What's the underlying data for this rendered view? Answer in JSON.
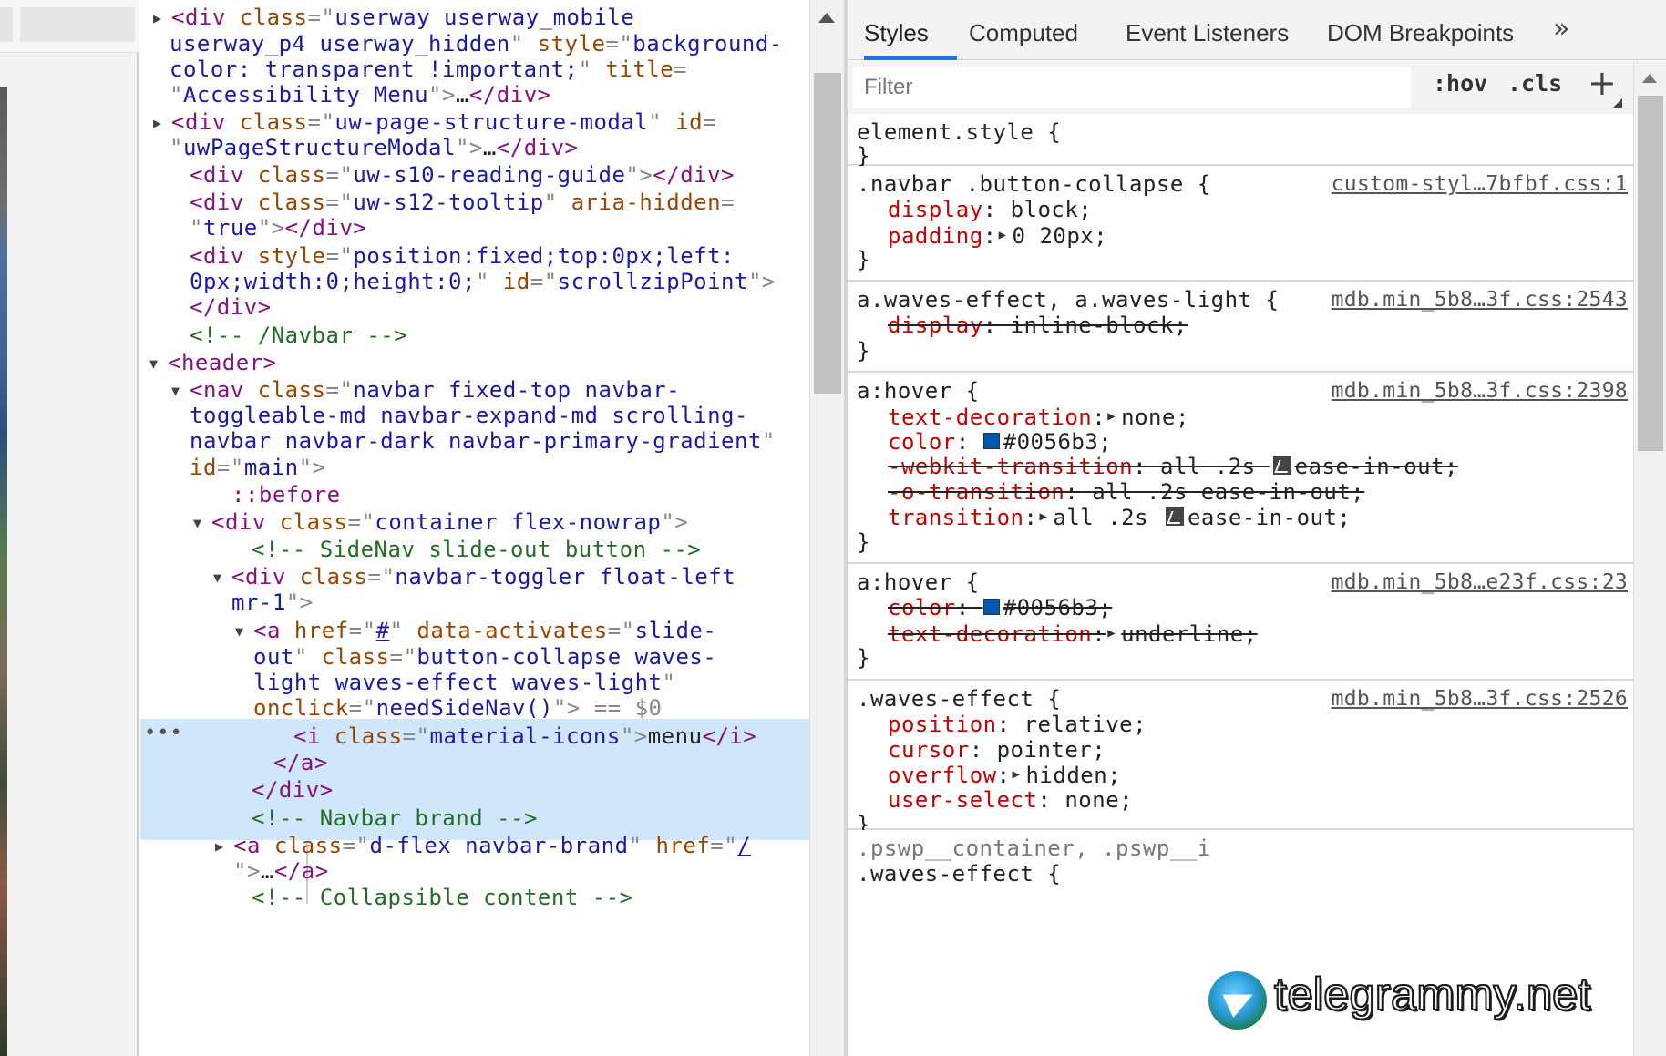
{
  "elements": {
    "lines": [
      {
        "t": [
          [
            "▶ ",
            "tri"
          ],
          [
            "<div ",
            "tag"
          ],
          [
            "class",
            "an"
          ],
          [
            "=\"",
            "dim"
          ],
          [
            "userway userway_mobile",
            "av"
          ]
        ]
      },
      {
        "t": [
          [
            "userway_p4 userway_hidden",
            "av"
          ],
          [
            "\" ",
            "dim"
          ],
          [
            "style",
            "an"
          ],
          [
            "=\"",
            "dim"
          ],
          [
            "background-",
            "av"
          ]
        ]
      },
      {
        "t": [
          [
            "color: transparent !important;",
            "av"
          ],
          [
            "\" ",
            "dim"
          ],
          [
            "title",
            "an"
          ],
          [
            "=",
            "dim"
          ]
        ]
      },
      {
        "t": [
          [
            "\"",
            "dim"
          ],
          [
            "Accessibility Menu",
            "av"
          ],
          [
            "\">",
            "dim"
          ],
          [
            "…",
            "txt"
          ],
          [
            "</div>",
            "tag"
          ]
        ]
      },
      {
        "t": [
          [
            "▶ ",
            "tri"
          ],
          [
            "<div ",
            "tag"
          ],
          [
            "class",
            "an"
          ],
          [
            "=\"",
            "dim"
          ],
          [
            "uw-page-structure-modal",
            "av"
          ],
          [
            "\" ",
            "dim"
          ],
          [
            "id",
            "an"
          ],
          [
            "=",
            "dim"
          ]
        ]
      },
      {
        "t": [
          [
            "\"",
            "dim"
          ],
          [
            "uwPageStructureModal",
            "av"
          ],
          [
            "\">",
            "dim"
          ],
          [
            "…",
            "txt"
          ],
          [
            "</div>",
            "tag"
          ]
        ]
      },
      {
        "t": [
          [
            "<div ",
            "tag"
          ],
          [
            "class",
            "an"
          ],
          [
            "=\"",
            "dim"
          ],
          [
            "uw-s10-reading-guide",
            "av"
          ],
          [
            "\">",
            "dim"
          ],
          [
            "</div>",
            "tag"
          ]
        ]
      },
      {
        "t": [
          [
            "<div ",
            "tag"
          ],
          [
            "class",
            "an"
          ],
          [
            "=\"",
            "dim"
          ],
          [
            "uw-s12-tooltip",
            "av"
          ],
          [
            "\" ",
            "dim"
          ],
          [
            "aria-hidden",
            "an"
          ],
          [
            "=",
            "dim"
          ]
        ]
      },
      {
        "t": [
          [
            "\"",
            "dim"
          ],
          [
            "true",
            "av"
          ],
          [
            "\">",
            "dim"
          ],
          [
            "</div>",
            "tag"
          ]
        ]
      },
      {
        "t": [
          [
            "<div ",
            "tag"
          ],
          [
            "style",
            "an"
          ],
          [
            "=\"",
            "dim"
          ],
          [
            "position:fixed;top:0px;left:",
            "av"
          ]
        ]
      },
      {
        "t": [
          [
            "0px;width:0;height:0;",
            "av"
          ],
          [
            "\" ",
            "dim"
          ],
          [
            "id",
            "an"
          ],
          [
            "=\"",
            "dim"
          ],
          [
            "scrollzipPoint",
            "av"
          ],
          [
            "\">",
            "dim"
          ]
        ]
      },
      {
        "t": [
          [
            "</div>",
            "tag"
          ]
        ]
      },
      {
        "t": [
          [
            "<!-- /Navbar -->",
            "cm"
          ]
        ]
      },
      {
        "t": [
          [
            "▼ ",
            "tri"
          ],
          [
            "<header>",
            "tag"
          ]
        ]
      },
      {
        "t": [
          [
            "▼ ",
            "tri"
          ],
          [
            "<nav ",
            "tag"
          ],
          [
            "class",
            "an"
          ],
          [
            "=\"",
            "dim"
          ],
          [
            "navbar fixed-top navbar-",
            "av"
          ]
        ]
      },
      {
        "t": [
          [
            "toggleable-md navbar-expand-md scrolling-",
            "av"
          ]
        ]
      },
      {
        "t": [
          [
            "navbar navbar-dark navbar-primary-gradient",
            "av"
          ],
          [
            "\"",
            "dim"
          ]
        ]
      },
      {
        "t": [
          [
            "id",
            "an"
          ],
          [
            "=\"",
            "dim"
          ],
          [
            "main",
            "av"
          ],
          [
            "\">",
            "dim"
          ]
        ]
      },
      {
        "t": [
          [
            "::before",
            "pe"
          ]
        ]
      },
      {
        "t": [
          [
            "▼ ",
            "tri"
          ],
          [
            "<div ",
            "tag"
          ],
          [
            "class",
            "an"
          ],
          [
            "=\"",
            "dim"
          ],
          [
            "container flex-nowrap",
            "av"
          ],
          [
            "\">",
            "dim"
          ]
        ]
      },
      {
        "t": [
          [
            "<!-- SideNav slide-out button -->",
            "cm"
          ]
        ]
      },
      {
        "t": [
          [
            "▼ ",
            "tri"
          ],
          [
            "<div ",
            "tag"
          ],
          [
            "class",
            "an"
          ],
          [
            "=\"",
            "dim"
          ],
          [
            "navbar-toggler float-left",
            "av"
          ]
        ]
      },
      {
        "t": [
          [
            "mr-1",
            "av"
          ],
          [
            "\">",
            "dim"
          ]
        ]
      },
      {
        "t": [
          [
            "▼ ",
            "tri"
          ],
          [
            "<a ",
            "tag"
          ],
          [
            "href",
            "an"
          ],
          [
            "=\"",
            "dim"
          ],
          [
            "#",
            "link"
          ],
          [
            "\" ",
            "dim"
          ],
          [
            "data-activates",
            "an"
          ],
          [
            "=\"",
            "dim"
          ],
          [
            "slide-",
            "av"
          ]
        ]
      },
      {
        "t": [
          [
            "out",
            "av"
          ],
          [
            "\" ",
            "dim"
          ],
          [
            "class",
            "an"
          ],
          [
            "=\"",
            "dim"
          ],
          [
            "button-collapse waves-",
            "av"
          ]
        ]
      },
      {
        "t": [
          [
            "light waves-effect waves-light",
            "av"
          ],
          [
            "\"",
            "dim"
          ]
        ]
      },
      {
        "t": [
          [
            "onclick",
            "an"
          ],
          [
            "=\"",
            "dim"
          ],
          [
            "needSideNav()",
            "av"
          ],
          [
            "\">",
            "dim"
          ],
          [
            " == $0",
            "dim"
          ]
        ]
      },
      {
        "t": [
          [
            "<i ",
            "tag"
          ],
          [
            "class",
            "an"
          ],
          [
            "=\"",
            "dim"
          ],
          [
            "material-icons",
            "av"
          ],
          [
            "\">",
            "dim"
          ],
          [
            "menu",
            "txt"
          ],
          [
            "</i>",
            "tag"
          ]
        ]
      },
      {
        "t": [
          [
            "</a>",
            "tag"
          ]
        ]
      },
      {
        "t": [
          [
            "</div>",
            "tag"
          ]
        ]
      },
      {
        "t": [
          [
            "<!-- Navbar brand -->",
            "cm"
          ]
        ]
      },
      {
        "t": [
          [
            "▶ ",
            "tri"
          ],
          [
            "<a ",
            "tag"
          ],
          [
            "class",
            "an"
          ],
          [
            "=\"",
            "dim"
          ],
          [
            "d-flex navbar-brand",
            "av"
          ],
          [
            "\" ",
            "dim"
          ],
          [
            "href",
            "an"
          ],
          [
            "=\"",
            "dim"
          ],
          [
            "/",
            "link"
          ]
        ]
      },
      {
        "t": [
          [
            "\">",
            "dim"
          ],
          [
            "…",
            "txt"
          ],
          [
            "</a>",
            "tag"
          ]
        ]
      },
      {
        "t": [
          [
            "<!-- Collapsible content -->",
            "cm"
          ]
        ]
      }
    ],
    "selected_marker": "•••"
  },
  "styles": {
    "tabs": [
      "Styles",
      "Computed",
      "Event Listeners",
      "DOM Breakpoints"
    ],
    "active_tab": "Styles",
    "more_tabs_icon": "double-chevron-right-icon",
    "filter_placeholder": "Filter",
    "hov": ":hov",
    "cls": ".cls",
    "new_rule_icon": "+",
    "rules": [
      {
        "selector": "element.style {",
        "source": "",
        "lines": [],
        "close": "}"
      },
      {
        "selector": ".navbar .button-collapse {",
        "source": "custom-styl…7bfbf.css:1",
        "lines": [
          {
            "p": "display",
            "v": "block;",
            "s": false
          },
          {
            "p": "padding",
            "v": "0 20px;",
            "s": false,
            "arrow": true
          }
        ],
        "close": "}"
      },
      {
        "selector": "a.waves-effect, a.waves-light {",
        "source": "mdb.min_5b8…3f.css:2543",
        "lines": [
          {
            "p": "display",
            "v": "inline-block;",
            "s": true
          }
        ],
        "close": "}"
      },
      {
        "selector": "a:hover {",
        "source": "mdb.min_5b8…3f.css:2398",
        "lines": [
          {
            "p": "text-decoration",
            "v": "none;",
            "s": false,
            "arrow": true
          },
          {
            "p": "color",
            "v": "#0056b3;",
            "s": false,
            "swatch": "#0056b3"
          },
          {
            "p": "-webkit-transition",
            "v": ".2s ",
            "v2": "ease-in-out;",
            "s": true,
            "pre": "all ",
            "ease": true
          },
          {
            "p": "-o-transition",
            "v": "all .2s ease-in-out;",
            "s": true
          },
          {
            "p": "transition",
            "v": ".2s ",
            "v2": "ease-in-out;",
            "s": false,
            "arrow": true,
            "pre": "all ",
            "ease": true
          }
        ],
        "close": "}"
      },
      {
        "selector": "a:hover {",
        "source": "mdb.min_5b8…e23f.css:23",
        "lines": [
          {
            "p": "color",
            "v": "#0056b3;",
            "s": true,
            "swatch": "#0056b3"
          },
          {
            "p": "text-decoration",
            "v": "underline;",
            "s": true,
            "arrow": true
          }
        ],
        "close": "}"
      },
      {
        "selector": ".waves-effect {",
        "source": "mdb.min_5b8…3f.css:2526",
        "lines": [
          {
            "p": "position",
            "v": "relative;",
            "s": false
          },
          {
            "p": "cursor",
            "v": "pointer;",
            "s": false
          },
          {
            "p": "overflow",
            "v": "hidden;",
            "s": false,
            "arrow": true
          },
          {
            "p": "user-select",
            "v": "none;",
            "s": false
          }
        ],
        "close": "}"
      },
      {
        "selector": ".pswp__container, .pswp__i",
        "selector2": ".waves-effect {",
        "source": "",
        "lines": [],
        "close": ""
      }
    ]
  },
  "watermark": {
    "text": "telegrammy.net"
  },
  "colors": {
    "selection": "#cfe6fb",
    "tab_underline": "#1a73e8",
    "swatch": "#0056b3"
  }
}
